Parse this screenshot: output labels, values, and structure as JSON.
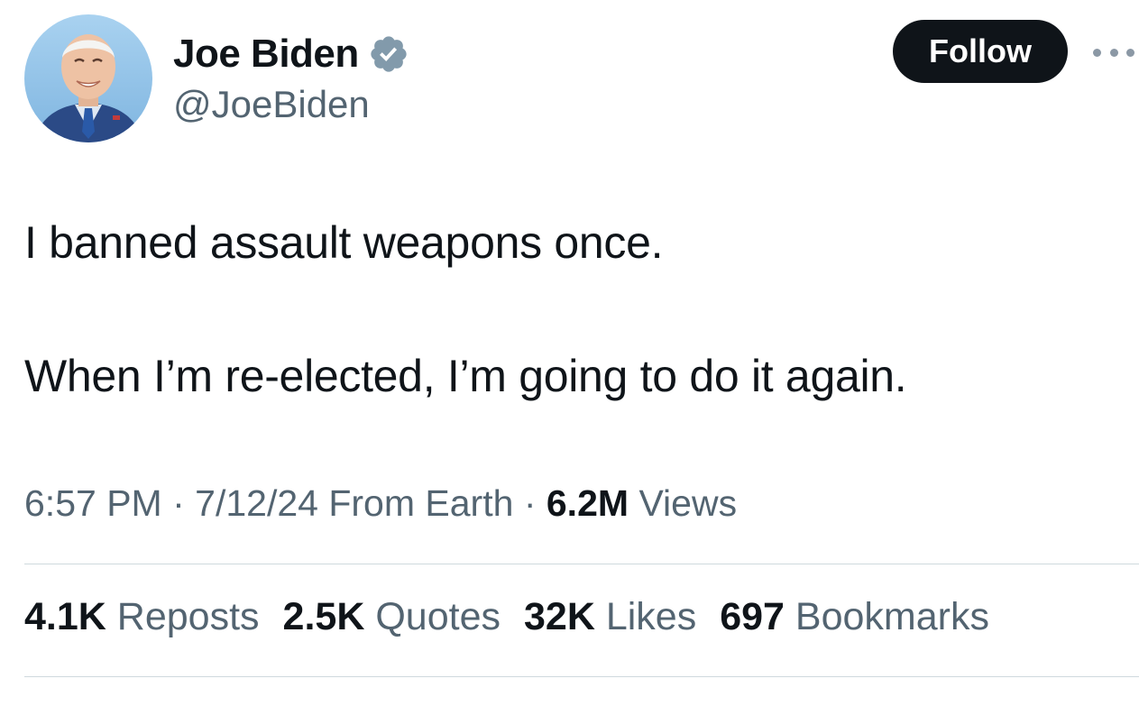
{
  "author": {
    "display_name": "Joe Biden",
    "handle": "@JoeBiden",
    "avatar_icon": "profile-photo",
    "verified_icon": "verified-badge-icon",
    "verified_color": "#829aab"
  },
  "actions": {
    "follow_label": "Follow",
    "more_icon": "more-options-icon"
  },
  "tweet": {
    "line_1": "I banned assault weapons once.",
    "line_2": "When I’m re-elected, I’m going to do it again."
  },
  "meta": {
    "time": "6:57 PM",
    "separator_1": "·",
    "date_source": "7/12/24 From Earth",
    "separator_2": "·",
    "views_count": "6.2M",
    "views_label": "Views"
  },
  "stats": [
    {
      "count": "4.1K",
      "label": "Reposts"
    },
    {
      "count": "2.5K",
      "label": "Quotes"
    },
    {
      "count": "32K",
      "label": "Likes"
    },
    {
      "count": "697",
      "label": "Bookmarks"
    }
  ],
  "colors": {
    "text_primary": "#0f1419",
    "text_secondary": "#536471",
    "follow_bg": "#0f1419",
    "divider": "#cfd9de"
  }
}
